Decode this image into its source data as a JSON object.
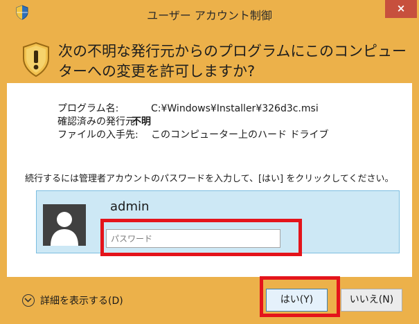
{
  "window": {
    "title": "ユーザー アカウント制御",
    "close_label": "×"
  },
  "header": {
    "question": "次の不明な発行元からのプログラムにこのコンピューターへの変更を許可しますか?"
  },
  "info": {
    "rows": [
      {
        "label": "プログラム名:",
        "value": "C:¥Windows¥Installer¥326d3c.msi"
      },
      {
        "label": "確認済みの発行元:",
        "value": "不明"
      },
      {
        "label": "ファイルの入手先:",
        "value": "このコンピューター上のハード ドライブ"
      }
    ]
  },
  "credentials": {
    "instruction": "続行するには管理者アカウントのパスワードを入力して、[はい] をクリックしてください。",
    "username": "admin",
    "password_placeholder": "パスワード",
    "password_value": ""
  },
  "footer": {
    "details_label": "詳細を表示する(D)",
    "yes_label": "はい(Y)",
    "no_label": "いいえ(N)"
  },
  "colors": {
    "frame": "#ecb14a",
    "close": "#c7503d",
    "credential_panel": "#cde8f5",
    "highlight": "#e4141b"
  },
  "icons": {
    "title": "uac-shield-icon",
    "header": "warning-shield-icon",
    "avatar": "user-avatar-icon",
    "details": "chevron-down-circle-icon"
  }
}
